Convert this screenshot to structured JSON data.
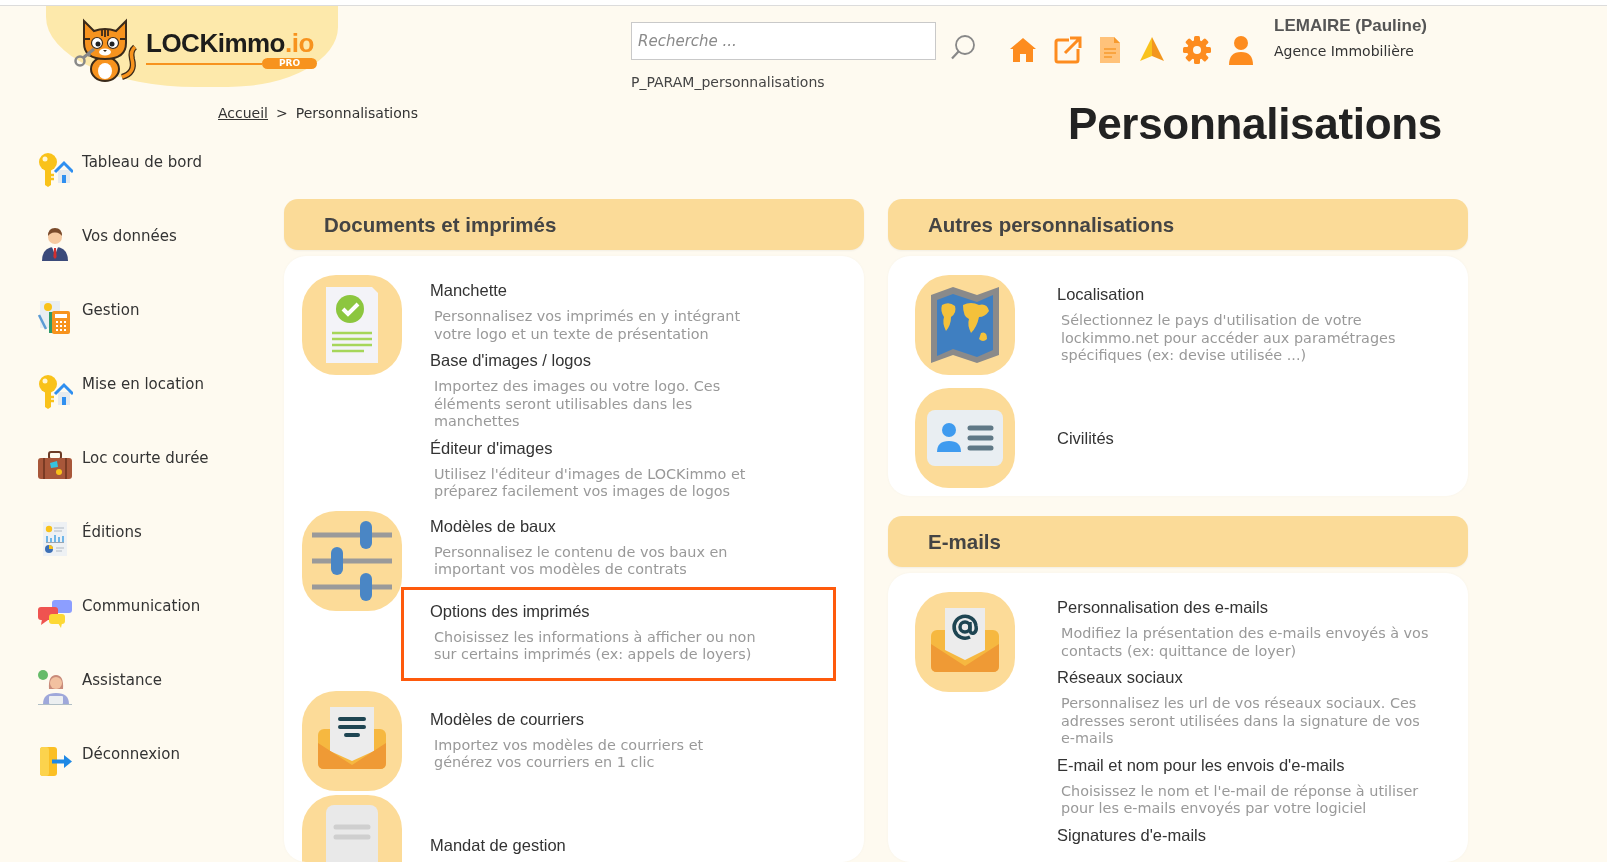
{
  "logo": {
    "wordmark": "LOCKimmo",
    "suffix": ".io",
    "badge": "PRO"
  },
  "search": {
    "placeholder": "Recherche ..."
  },
  "page_code": "P_PARAM_personnalisations",
  "user": {
    "name": "LEMAIRE (Pauline)",
    "agency": "Agence Immobilière"
  },
  "breadcrumb": {
    "separator": ">",
    "items": [
      {
        "label": "Accueil",
        "link": true
      },
      {
        "label": "Personnalisations",
        "link": false
      }
    ]
  },
  "page_title": "Personnalisations",
  "sidebar": {
    "items": [
      {
        "label": "Tableau de bord"
      },
      {
        "label": "Vos données"
      },
      {
        "label": "Gestion"
      },
      {
        "label": "Mise en location"
      },
      {
        "label": "Loc courte durée"
      },
      {
        "label": "Éditions"
      },
      {
        "label": "Communication"
      },
      {
        "label": "Assistance"
      },
      {
        "label": "Déconnexion"
      }
    ]
  },
  "columns": [
    {
      "panels": [
        {
          "title": "Documents et imprimés",
          "groups": [
            {
              "items": [
                {
                  "title": "Manchette",
                  "description": "Personnalisez vos imprimés en y intégrant votre logo et un texte de présentation",
                  "highlighted": false
                },
                {
                  "title": "Base d'images / logos",
                  "description": "Importez des images ou votre logo. Ces éléments seront utilisables dans les manchettes",
                  "highlighted": false
                },
                {
                  "title": "Éditeur d'images",
                  "description": "Utilisez l'éditeur d'images de LOCKimmo et préparez facilement vos images de logos",
                  "highlighted": false
                }
              ]
            },
            {
              "items": [
                {
                  "title": "Modèles de baux",
                  "description": "Personnalisez le contenu de vos baux en important vos modèles de contrats",
                  "highlighted": false
                },
                {
                  "title": "Options des imprimés",
                  "description": "Choisissez les informations à afficher ou non sur certains imprimés (ex: appels de loyers)",
                  "highlighted": true
                }
              ]
            },
            {
              "items": [
                {
                  "title": "Modèles de courriers",
                  "description": "Importez vos modèles de courriers et générez vos courriers en 1 clic",
                  "highlighted": false
                }
              ]
            },
            {
              "items": [
                {
                  "title": "Mandat de gestion",
                  "highlighted": false
                }
              ]
            }
          ]
        }
      ]
    },
    {
      "panels": [
        {
          "title": "Autres personnalisations",
          "groups": [
            {
              "items": [
                {
                  "title": "Localisation",
                  "description": "Sélectionnez le pays d'utilisation de votre lockimmo.net pour accéder aux paramétrages spécifiques (ex: devise utilisée ...)",
                  "highlighted": false
                }
              ]
            },
            {
              "items": [
                {
                  "title": "Civilités",
                  "highlighted": false
                }
              ]
            }
          ]
        },
        {
          "title": "E-mails",
          "groups": [
            {
              "items": [
                {
                  "title": "Personnalisation des e-mails",
                  "description": "Modifiez la présentation des e-mails envoyés à vos contacts (ex: quittance de loyer)",
                  "highlighted": false
                },
                {
                  "title": "Réseaux sociaux",
                  "description": "Personnalisez les url de vos réseaux sociaux. Ces adresses seront utilisées dans la signature de vos e-mails",
                  "highlighted": false
                },
                {
                  "title": "E-mail et nom pour les envois d'e-mails",
                  "description": "Choisissez le nom et l'e-mail de réponse à utiliser pour les e-mails envoyés par votre logiciel",
                  "highlighted": false
                },
                {
                  "title": "Signatures d'e-mails",
                  "highlighted": false
                }
              ]
            }
          ]
        }
      ]
    }
  ]
}
